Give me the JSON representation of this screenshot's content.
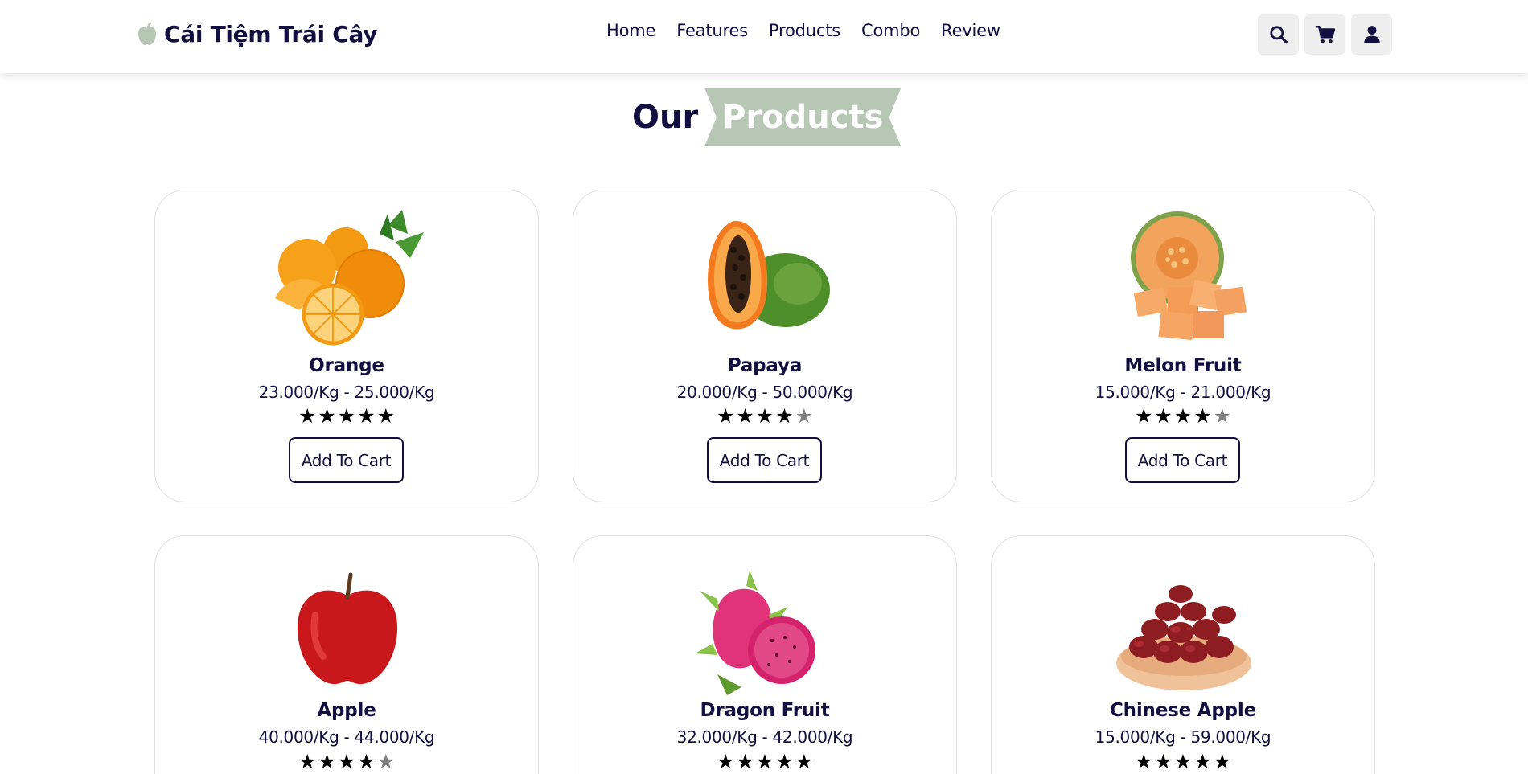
{
  "header": {
    "logo_text": "Cái Tiệm Trái Cây",
    "nav": [
      "Home",
      "Features",
      "Products",
      "Combo",
      "Review"
    ],
    "icons": [
      "search-icon",
      "cart-icon",
      "user-icon"
    ]
  },
  "section": {
    "heading_plain": "Our",
    "heading_badge": "Products",
    "badge_color": "#b6c7b4"
  },
  "products": [
    {
      "name": "Orange",
      "price": "23.000/Kg - 25.000/Kg",
      "rating": 5,
      "button": "Add To Cart",
      "image": "orange"
    },
    {
      "name": "Papaya",
      "price": "20.000/Kg - 50.000/Kg",
      "rating": 4,
      "button": "Add To Cart",
      "image": "papaya"
    },
    {
      "name": "Melon Fruit",
      "price": "15.000/Kg - 21.000/Kg",
      "rating": 4,
      "button": "Add To Cart",
      "image": "melon"
    },
    {
      "name": "Apple",
      "price": "40.000/Kg - 44.000/Kg",
      "rating": 4,
      "button": "Add To Cart",
      "image": "apple"
    },
    {
      "name": "Dragon Fruit",
      "price": "32.000/Kg - 42.000/Kg",
      "rating": 5,
      "button": "Add To Cart",
      "image": "dragon-fruit"
    },
    {
      "name": "Chinese Apple",
      "price": "15.000/Kg - 59.000/Kg",
      "rating": 5,
      "button": "Add To Cart",
      "image": "jujube"
    }
  ]
}
